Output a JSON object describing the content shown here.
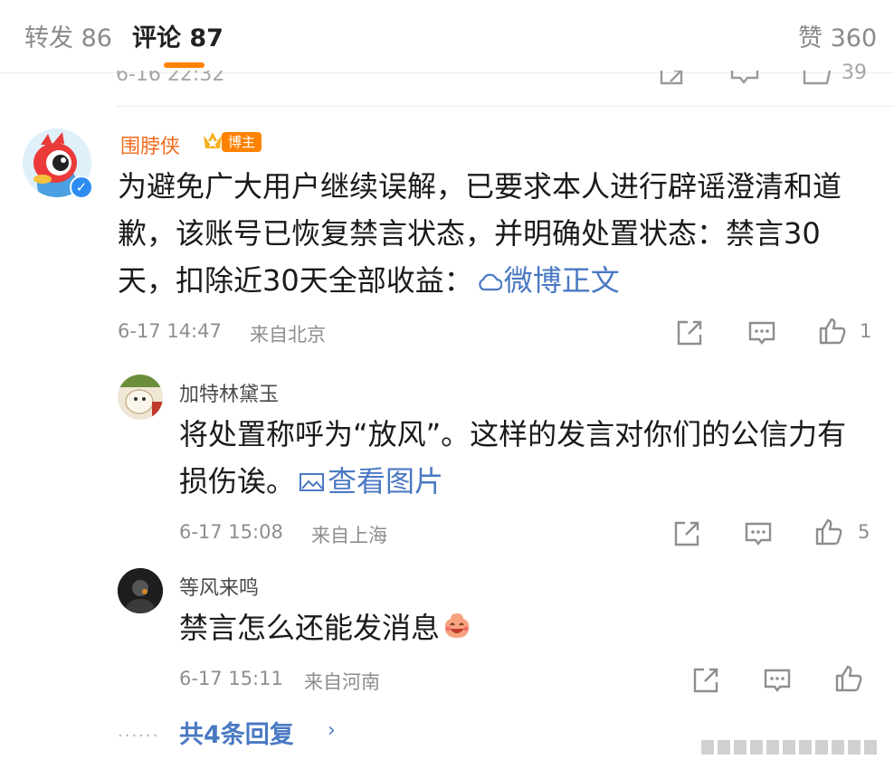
{
  "tabs": [
    {
      "label": "转发 86"
    },
    {
      "label": "评论 87"
    },
    {
      "label": "赞 360"
    }
  ],
  "previous": {
    "time": "6-16 22:32",
    "like_count": "39"
  },
  "main_comment": {
    "username": "围脖侠",
    "badge": "博主",
    "text": "为避免广大用户继续误解，已要求本人进行辟谣澄清和道歉，该账号已恢复禁言状态，并明确处置状态：禁言30天，扣除近30天全部收益：",
    "link": "微博正文",
    "time": "6-17 14:47",
    "location": "来自北京",
    "like_count": "1"
  },
  "replies": [
    {
      "username": "加特林黛玉",
      "text": "将处置称呼为“放风”。这样的发言对你们的公信力有损伤诶。",
      "link": "查看图片",
      "time": "6-17 15:08",
      "location": "来自上海",
      "like_count": "5"
    },
    {
      "username": "等风来鸣",
      "text": "禁言怎么还能发消息",
      "time": "6-17 15:11",
      "location": "来自河南",
      "like_count": ""
    }
  ],
  "more_replies": "共4条回复",
  "colors": {
    "accent": "#ff8200",
    "link": "#4a79c3",
    "username": "#f16c1f"
  }
}
